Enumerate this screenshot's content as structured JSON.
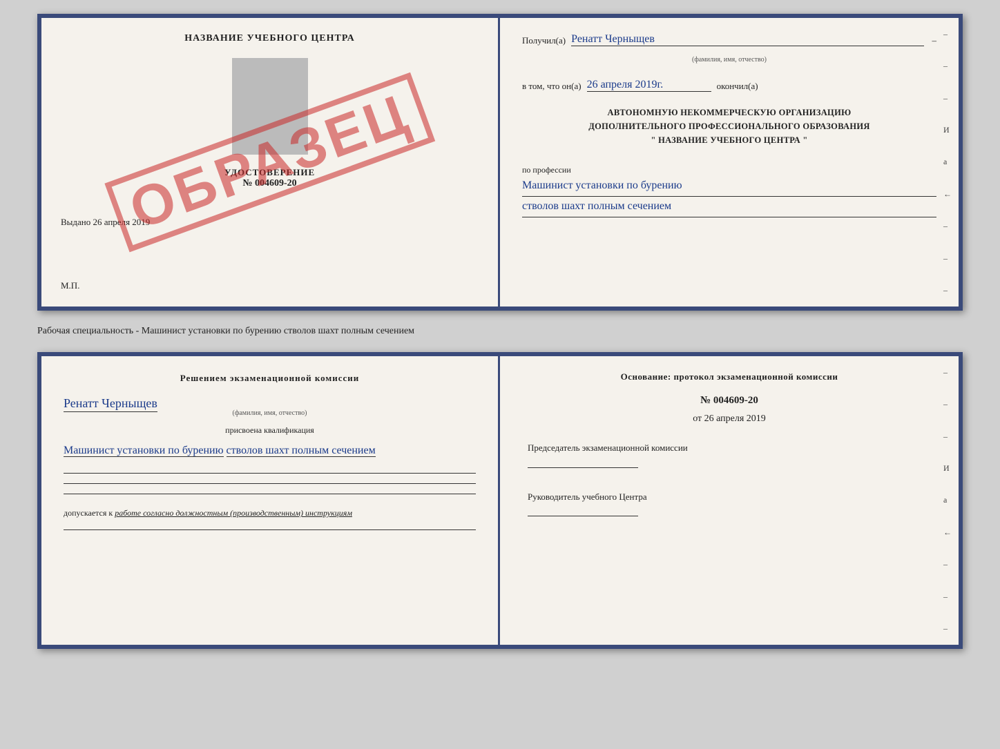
{
  "certificate": {
    "left": {
      "title": "НАЗВАНИЕ УЧЕБНОГО ЦЕНТРА",
      "udostLabel": "УДОСТОВЕРЕНИЕ",
      "udostNumber": "№ 004609-20",
      "vydanoLabel": "Выдано",
      "vydanoDate": "26 апреля 2019",
      "mpLabel": "М.П.",
      "obrazets": "ОБРАЗЕЦ"
    },
    "right": {
      "poluchilLabel": "Получил(а)",
      "name": "Ренатт Черныщев",
      "nameSublabel": "(фамилия, имя, отчество)",
      "vTomLabel": "в том, что он(а)",
      "date": "26 апреля 2019г.",
      "okonchilLabel": "окончил(а)",
      "bodyLine1": "АВТОНОМНУЮ НЕКОММЕРЧЕСКУЮ ОРГАНИЗАЦИЮ",
      "bodyLine2": "ДОПОЛНИТЕЛЬНОГО ПРОФЕССИОНАЛЬНОГО ОБРАЗОВАНИЯ",
      "bodyLine3": "\"  НАЗВАНИЕ УЧЕБНОГО ЦЕНТРА  \"",
      "professiiLabel": "по профессии",
      "professionHandwritten1": "Машинист установки по бурению",
      "professionHandwritten2": "стволов шахт полным сечением",
      "marginChars": [
        "–",
        "–",
        "–",
        "И",
        "а",
        "←",
        "–",
        "–",
        "–"
      ]
    }
  },
  "specialtyLabel": "Рабочая специальность - Машинист установки по бурению стволов шахт полным сечением",
  "bottom": {
    "left": {
      "titleLine1": "Решением  экзаменационной  комиссии",
      "name": "Ренатт Черныщев",
      "nameSublabel": "(фамилия, имя, отчество)",
      "assignedLabel": "присвоена квалификация",
      "profession1": "Машинист установки по бурению",
      "profession2": "стволов шахт полным сечением",
      "допускLabel": "допускается к",
      "допускItalic": "работе согласно должностным (производственным) инструкциям"
    },
    "right": {
      "osnovLabel": "Основание: протокол экзаменационной  комиссии",
      "number": "№  004609-20",
      "dateLabel": "от",
      "date": "26 апреля 2019",
      "chairmanLabel": "Председатель экзаменационной комиссии",
      "headLabel": "Руководитель учебного Центра",
      "marginChars": [
        "–",
        "–",
        "–",
        "И",
        "а",
        "←",
        "–",
        "–",
        "–"
      ]
    }
  }
}
